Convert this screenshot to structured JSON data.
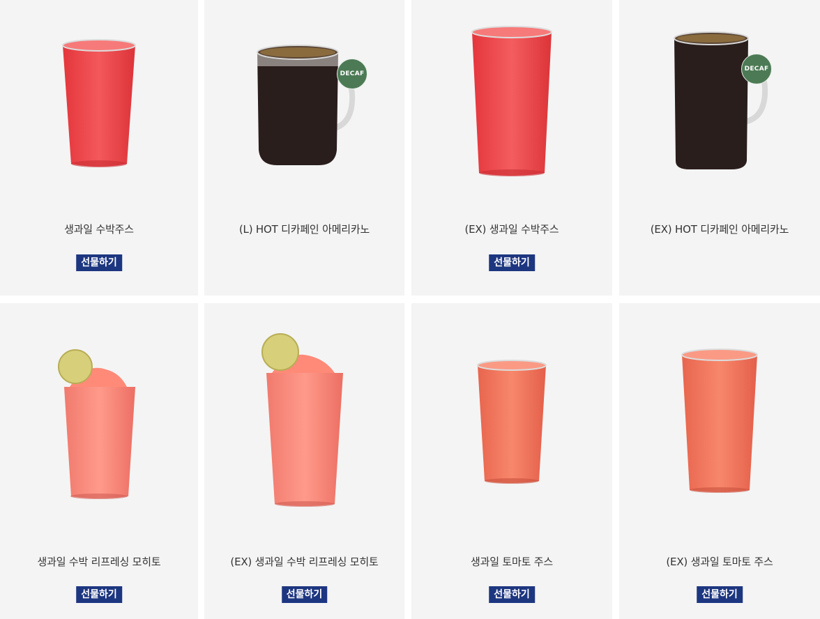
{
  "products": [
    {
      "name": "생과일 수박주스",
      "gift_label": "선물하기",
      "icon": "watermelon-juice-glass"
    },
    {
      "name": "(L) HOT 디카페인 아메리카노",
      "badge": "DECAF",
      "icon": "coffee-mug"
    },
    {
      "name": "(EX) 생과일 수박주스",
      "gift_label": "선물하기",
      "icon": "watermelon-juice-glass"
    },
    {
      "name": "(EX) HOT 디카페인 아메리카노",
      "badge": "DECAF",
      "icon": "coffee-mug"
    },
    {
      "name": "생과일 수박 리프레싱 모히토",
      "gift_label": "선물하기",
      "icon": "watermelon-mojito-glass"
    },
    {
      "name": "(EX) 생과일 수박 리프레싱 모히토",
      "gift_label": "선물하기",
      "icon": "watermelon-mojito-glass"
    },
    {
      "name": "생과일 토마토 주스",
      "gift_label": "선물하기",
      "icon": "tomato-juice-glass"
    },
    {
      "name": "(EX) 생과일 토마토 주스",
      "gift_label": "선물하기",
      "icon": "tomato-juice-glass"
    }
  ],
  "colors": {
    "card_bg": "#f4f4f4",
    "gift_button": "#1d3680",
    "decaf_badge": "#4c7a55",
    "watermelon": "#ef4a4f",
    "tomato": "#f07658",
    "coffee": "#2a1e1c"
  }
}
